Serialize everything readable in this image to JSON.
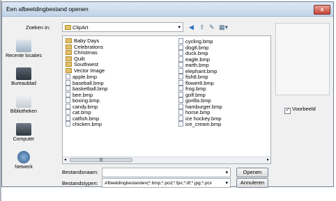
{
  "dialog": {
    "title": "Een afbeeldingbestand openen",
    "close_label": "x"
  },
  "lookin": {
    "label": "Zoeken in:",
    "value": "ClipArt"
  },
  "toolbar_icons": [
    "back-icon",
    "up-folder-icon",
    "new-folder-icon",
    "view-menu-icon"
  ],
  "places": [
    {
      "label": "Recente locaties",
      "icon": "recent-locations-icon"
    },
    {
      "label": "Bureaublad",
      "icon": "desktop-icon"
    },
    {
      "label": "Bibliotheken",
      "icon": "libraries-icon"
    },
    {
      "label": "Computer",
      "icon": "computer-icon"
    },
    {
      "label": "Netwerk",
      "icon": "network-icon"
    }
  ],
  "files_col1": [
    {
      "name": "Baby Days",
      "type": "folder"
    },
    {
      "name": "Celebrations",
      "type": "folder"
    },
    {
      "name": "Christmas",
      "type": "folder"
    },
    {
      "name": "Quilt",
      "type": "folder"
    },
    {
      "name": "Southwest",
      "type": "folder"
    },
    {
      "name": "Vector Image",
      "type": "folder"
    },
    {
      "name": "apple.bmp",
      "type": "file"
    },
    {
      "name": "baseball.bmp",
      "type": "file"
    },
    {
      "name": "basketball.bmp",
      "type": "file"
    },
    {
      "name": "bee.bmp",
      "type": "file"
    },
    {
      "name": "boxing.bmp",
      "type": "file"
    },
    {
      "name": "candy.bmp",
      "type": "file"
    },
    {
      "name": "cat.bmp",
      "type": "file"
    },
    {
      "name": "catfish.bmp",
      "type": "file"
    },
    {
      "name": "chicken.bmp",
      "type": "file"
    }
  ],
  "files_col2": [
    {
      "name": "cycling.bmp",
      "type": "file"
    },
    {
      "name": "dog8.bmp",
      "type": "file"
    },
    {
      "name": "duck.bmp",
      "type": "file"
    },
    {
      "name": "eagle.bmp",
      "type": "file"
    },
    {
      "name": "earth.bmp",
      "type": "file"
    },
    {
      "name": "elephant.bmp",
      "type": "file"
    },
    {
      "name": "fish8.bmp",
      "type": "file"
    },
    {
      "name": "flower8.bmp",
      "type": "file"
    },
    {
      "name": "frog.bmp",
      "type": "file"
    },
    {
      "name": "golf.bmp",
      "type": "file"
    },
    {
      "name": "gorilla.bmp",
      "type": "file"
    },
    {
      "name": "hamburger.bmp",
      "type": "file"
    },
    {
      "name": "horse.bmp",
      "type": "file"
    },
    {
      "name": "ice hockey.bmp",
      "type": "file"
    },
    {
      "name": "ice_cream.bmp",
      "type": "file"
    }
  ],
  "preview": {
    "checkbox_label": "Voorbeeld",
    "checked": true
  },
  "filename": {
    "label": "Bestandsnaam:",
    "value": ""
  },
  "filetype": {
    "label": "Bestandstypen:",
    "value": "Afbeeldingbestanden(*.bmp;*.pcd;*.fpx;*.tif;*.jpg;*.pcx"
  },
  "buttons": {
    "open": "Openen",
    "cancel": "Annuleren"
  },
  "colors": {
    "folder": "#e3c26a",
    "titlebar": "#c2d3e8",
    "close": "#c6463a"
  }
}
